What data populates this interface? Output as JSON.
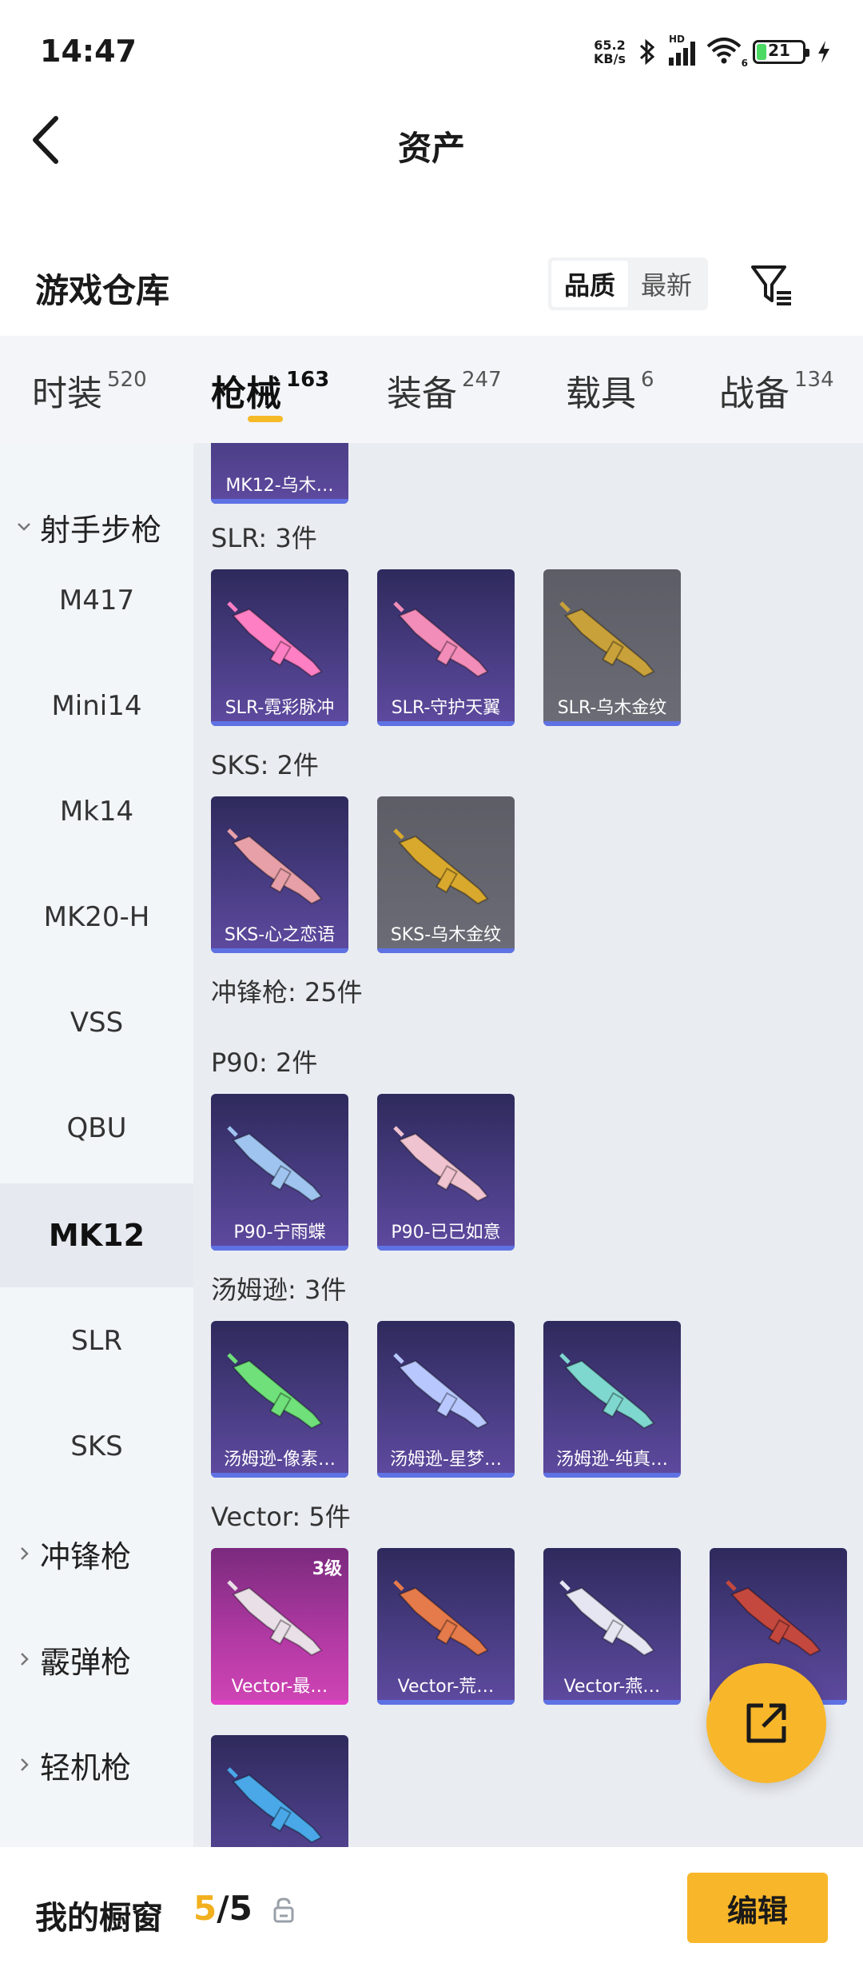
{
  "status_bar": {
    "time": "14:47",
    "net_speed_value": "65.2",
    "net_speed_unit": "KB/s",
    "hd_label": "HD",
    "wifi_sub": "6",
    "battery": "21"
  },
  "header": {
    "title": "资产"
  },
  "warehouse": {
    "title": "游戏仓库",
    "sort": [
      "品质",
      "最新"
    ],
    "active_sort": "品质"
  },
  "tabs": [
    {
      "name": "时装",
      "count": "520"
    },
    {
      "name": "枪械",
      "count": "163",
      "active": true
    },
    {
      "name": "装备",
      "count": "247"
    },
    {
      "name": "载具",
      "count": "6"
    },
    {
      "name": "战备",
      "count": "134"
    }
  ],
  "sidebar": {
    "group_dmr": "射手步枪",
    "items": [
      "M417",
      "Mini14",
      "Mk14",
      "MK20-H",
      "VSS",
      "QBU",
      "MK12",
      "SLR",
      "SKS"
    ],
    "active": "MK12",
    "group_smg": "冲锋枪",
    "group_shotgun": "霰弹枪",
    "group_lmg": "轻机枪"
  },
  "grid": {
    "partial_card": {
      "label": "MK12-乌木…"
    },
    "slr": {
      "title": "SLR: 3件",
      "cards": [
        {
          "label": "SLR-霓彩脉冲",
          "style": "purple",
          "gun_color": "#ff7fc4"
        },
        {
          "label": "SLR-守护天翼",
          "style": "purple",
          "gun_color": "#f28cb8"
        },
        {
          "label": "SLR-乌木金纹",
          "style": "gray",
          "gun_color": "#c9a13a"
        }
      ]
    },
    "sks": {
      "title": "SKS: 2件",
      "cards": [
        {
          "label": "SKS-心之恋语",
          "style": "purple",
          "gun_color": "#e8a0a8"
        },
        {
          "label": "SKS-乌木金纹",
          "style": "gray",
          "gun_color": "#d9a92e"
        }
      ]
    },
    "smg_title": "冲锋枪: 25件",
    "p90": {
      "title": "P90: 2件",
      "cards": [
        {
          "label": "P90-宁雨蝶",
          "style": "purple",
          "gun_color": "#9fc4f0"
        },
        {
          "label": "P90-已已如意",
          "style": "purple",
          "gun_color": "#f0c3d0"
        }
      ]
    },
    "thompson": {
      "title": "汤姆逊: 3件",
      "cards": [
        {
          "label": "汤姆逊-像素…",
          "style": "purple",
          "gun_color": "#6fe07a"
        },
        {
          "label": "汤姆逊-星梦…",
          "style": "purple",
          "gun_color": "#b8c8ff"
        },
        {
          "label": "汤姆逊-纯真…",
          "style": "purple",
          "gun_color": "#7fd8d0"
        }
      ]
    },
    "vector": {
      "title": "Vector: 5件",
      "cards": [
        {
          "label": "Vector-最…",
          "style": "magenta",
          "gun_color": "#e9dfe6",
          "level": "3级"
        },
        {
          "label": "Vector-荒…",
          "style": "purple",
          "gun_color": "#e57a4a"
        },
        {
          "label": "Vector-燕…",
          "style": "purple",
          "gun_color": "#e6e6f2"
        },
        {
          "label": "V…",
          "style": "purple",
          "gun_color": "#c4483e"
        },
        {
          "label": "",
          "style": "purple",
          "gun_color": "#4aa8e8"
        }
      ]
    }
  },
  "bottom": {
    "showcase_label": "我的橱窗",
    "showcase_current": "5",
    "showcase_sep": "/",
    "showcase_total": "5",
    "edit_label": "编辑"
  }
}
